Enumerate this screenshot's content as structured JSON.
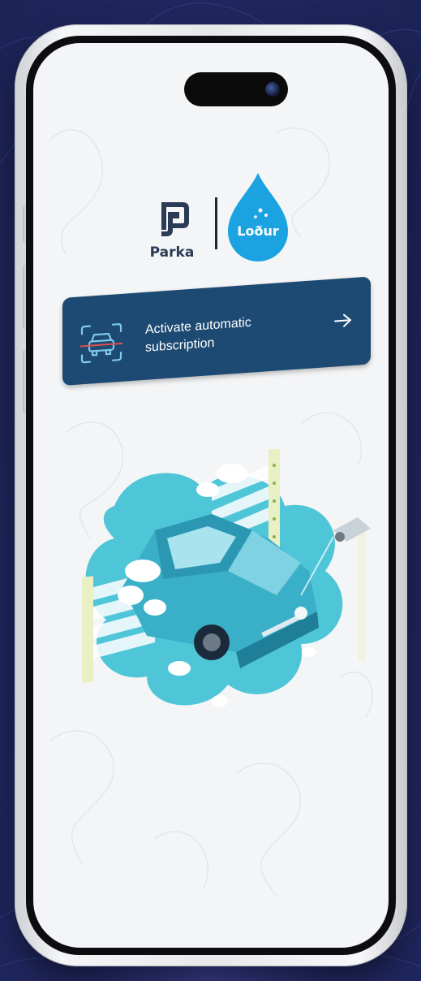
{
  "brand": {
    "parka_name": "Parka",
    "lodur_name": "Loður"
  },
  "banner": {
    "label": "Activate automatic subscription",
    "icon": "car-scan-icon",
    "arrow_icon": "arrow-right-icon"
  },
  "illustration": {
    "name": "car-wash-illustration"
  },
  "colors": {
    "background": "#232a66",
    "banner": "#1d4a72",
    "lodur_drop": "#1aa3e0",
    "parka_dark": "#2b3a55",
    "illustration_cloud": "#4fc6d8"
  }
}
